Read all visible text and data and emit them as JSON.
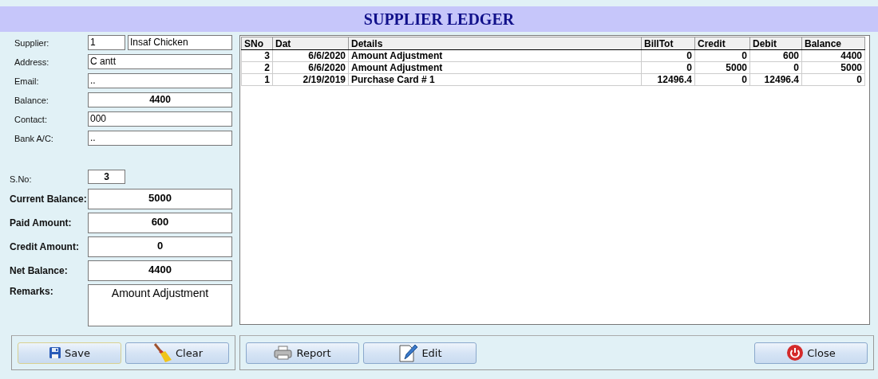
{
  "window": {
    "title": "SUPPLIER LEDGER"
  },
  "supplier_info": [
    {
      "label": "Supplier:",
      "kind": "pair",
      "values": [
        "1",
        "Insaf Chicken"
      ]
    },
    {
      "label": "Address:",
      "kind": "text",
      "values": [
        "C antt"
      ]
    },
    {
      "label": "Email:",
      "kind": "text",
      "values": [
        ".."
      ]
    },
    {
      "label": "Balance:",
      "kind": "total",
      "values": [
        "4400"
      ]
    },
    {
      "label": "Contact:",
      "kind": "text",
      "values": [
        "000"
      ]
    },
    {
      "label": "Bank A/C:",
      "kind": "text",
      "values": [
        ".."
      ]
    }
  ],
  "entry": [
    {
      "label": "S.No:",
      "kind": "serial",
      "value": "3"
    },
    {
      "label": "Current Balance:",
      "kind": "amount",
      "value": "5000"
    },
    {
      "label": "Paid Amount:",
      "kind": "amount",
      "value": "600"
    },
    {
      "label": "Credit Amount:",
      "kind": "amount",
      "value": "0"
    },
    {
      "label": "Net Balance:",
      "kind": "amount",
      "value": "4400"
    },
    {
      "label": "Remarks:",
      "kind": "memo",
      "value": "Amount Adjustment"
    }
  ],
  "table": {
    "columns": [
      "SNo",
      "Dat",
      "Details",
      "BillTot",
      "Credit",
      "Debit",
      "Balance"
    ],
    "rows": [
      [
        "3",
        "6/6/2020",
        "Amount Adjustment",
        "0",
        "0",
        "600",
        "4400"
      ],
      [
        "2",
        "6/6/2020",
        "Amount Adjustment",
        "0",
        "5000",
        "0",
        "5000"
      ],
      [
        "1",
        "2/19/2019",
        "Purchase Card # 1",
        "12496.4",
        "0",
        "12496.4",
        "0"
      ]
    ]
  },
  "left_buttons": [
    {
      "label": "Save",
      "kind": "save",
      "focused": true
    },
    {
      "label": "Clear",
      "kind": "clear",
      "focused": false
    }
  ],
  "right_buttons": [
    {
      "label": "Report",
      "kind": "report",
      "focused": false
    },
    {
      "label": "Edit",
      "kind": "edit",
      "focused": false
    },
    {
      "label": "Close",
      "kind": "close",
      "focused": false
    }
  ]
}
